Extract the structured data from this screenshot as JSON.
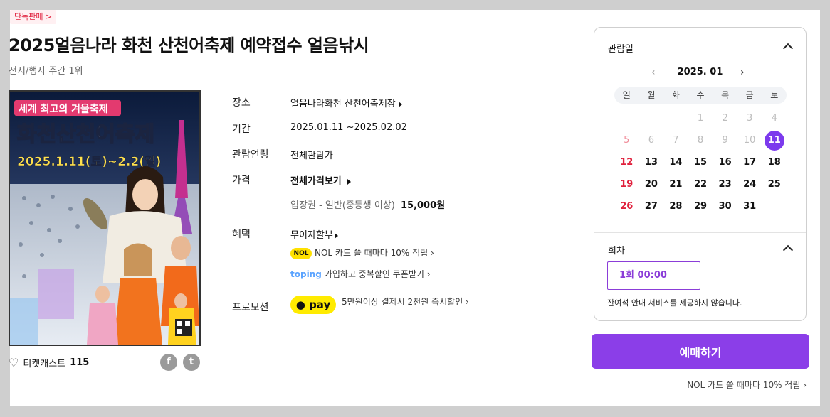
{
  "badge": "단독판매 >",
  "title": "2025얼음나라 화천 산천어축제 예약접수 얼음낚시",
  "rank": "전시/행사 주간 1위",
  "poster": {
    "headline_top": "세계 최고의 겨울축제",
    "headline_main": "화천산천어축제",
    "dates": "2025.1.11(토)~2.2(일)"
  },
  "likes": {
    "label": "티켓캐스트",
    "count": "115"
  },
  "share": {
    "facebook": "f",
    "twitter": "t"
  },
  "info": {
    "venue_label": "장소",
    "venue_value": "얼음나라화천 산천어축제장",
    "period_label": "기간",
    "period_value": "2025.01.11 ~2025.02.02",
    "age_label": "관람연령",
    "age_value": "전체관람가",
    "price_label": "가격",
    "price_all": "전체가격보기",
    "price_item": "입장권 - 일반(중등생 이상)",
    "price_amount": "15,000원",
    "benefit_label": "혜택",
    "benefit_installment": "무이자할부",
    "nol_logo": "NOL",
    "nol_text": "NOL 카드 쓸 때마다 10% 적립 ›",
    "toping_logo": "toping",
    "toping_text": "가입하고 중복할인 쿠폰받기 ›",
    "promo_label": "프로모션",
    "kpay_logo": "pay",
    "promo_text": "5만원이상 결제시 2천원 즉시할인 ›"
  },
  "calendar": {
    "section_title": "관람일",
    "month": "2025. 01",
    "prev": "‹",
    "next": "›",
    "weekdays": [
      "일",
      "월",
      "화",
      "수",
      "목",
      "금",
      "토"
    ],
    "weeks": [
      [
        "",
        "",
        "",
        "1",
        "2",
        "3",
        "4"
      ],
      [
        "5",
        "6",
        "7",
        "8",
        "9",
        "10",
        "11"
      ],
      [
        "12",
        "13",
        "14",
        "15",
        "16",
        "17",
        "18"
      ],
      [
        "19",
        "20",
        "21",
        "22",
        "23",
        "24",
        "25"
      ],
      [
        "26",
        "27",
        "28",
        "29",
        "30",
        "31",
        ""
      ]
    ],
    "selected": "11"
  },
  "session": {
    "section_title": "회차",
    "option": "1회 00:00",
    "notice": "잔여석 안내 서비스를 제공하지 않습니다."
  },
  "book_button": "예매하기",
  "bottom_promo": "NOL 카드 쓸 때마다 10% 적립 ›"
}
